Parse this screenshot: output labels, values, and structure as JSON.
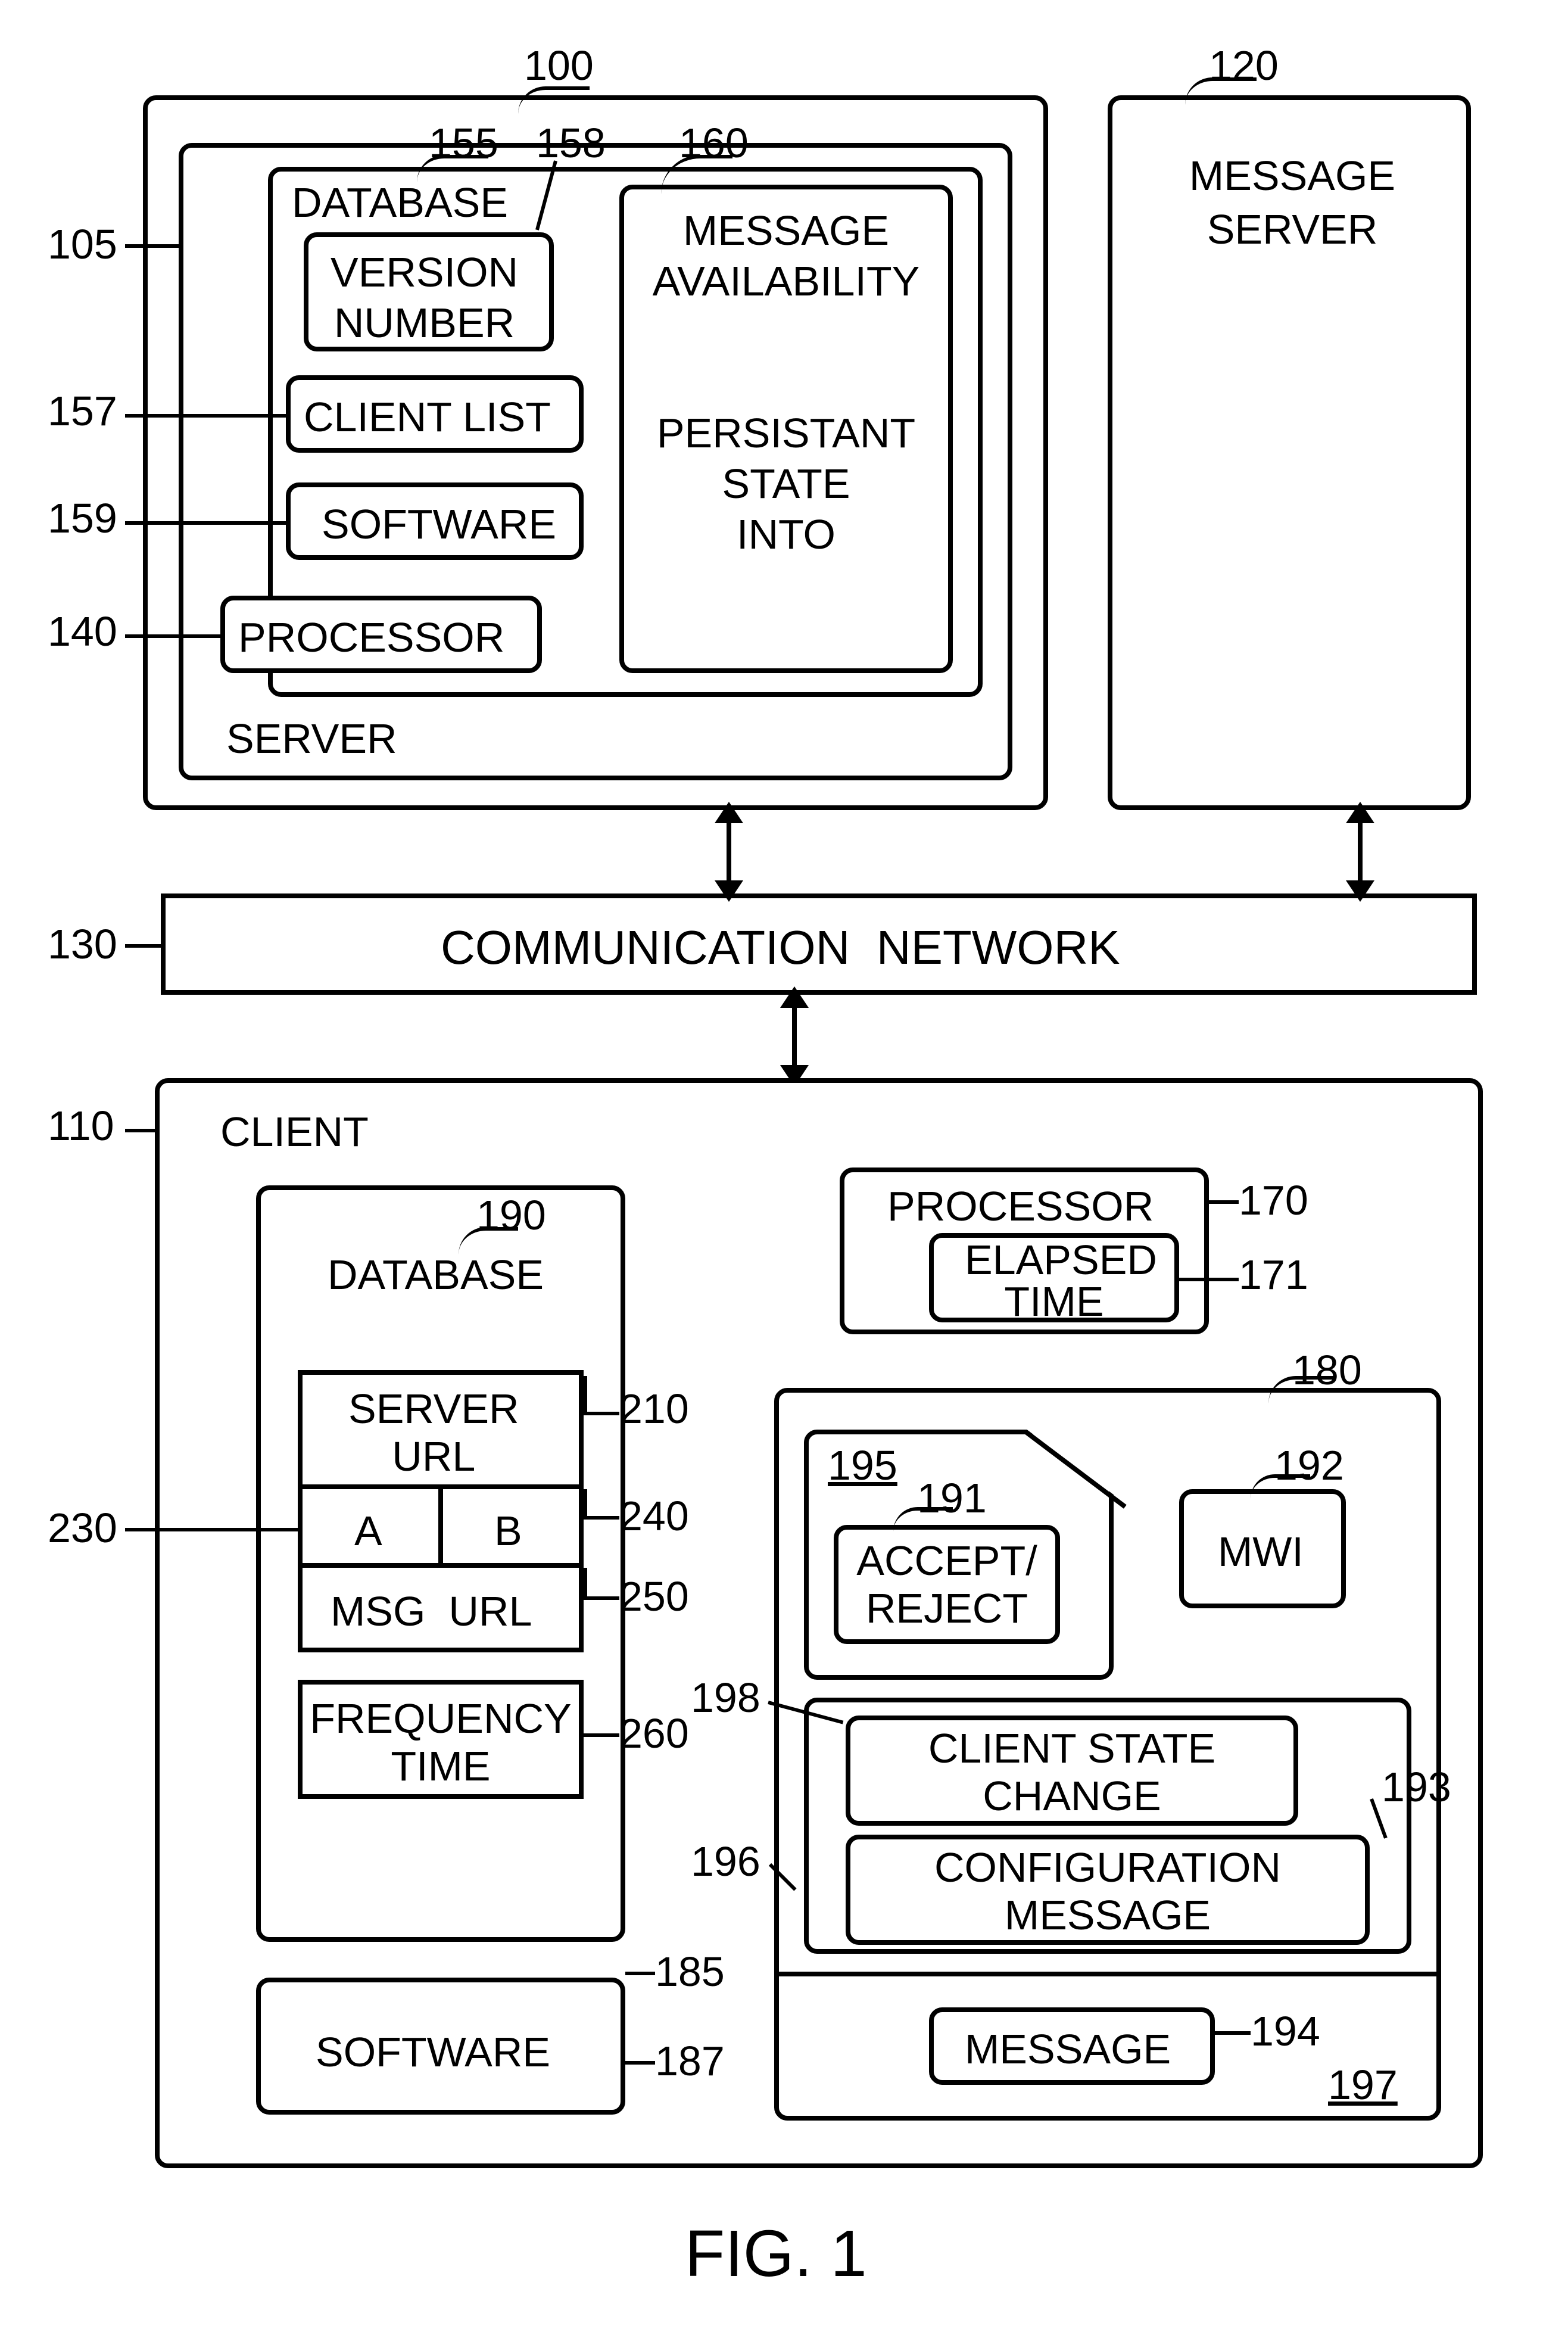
{
  "figure_caption": "FIG. 1",
  "refs": {
    "r100": "100",
    "r105": "105",
    "r110": "110",
    "r120": "120",
    "r130": "130",
    "r140": "140",
    "r155": "155",
    "r157": "157",
    "r158": "158",
    "r159": "159",
    "r160": "160",
    "r170": "170",
    "r171": "171",
    "r180": "180",
    "r185": "185",
    "r187": "187",
    "r190": "190",
    "r191": "191",
    "r192": "192",
    "r193": "193",
    "r194": "194",
    "r195": "195",
    "r196": "196",
    "r197": "197",
    "r198": "198",
    "r210": "210",
    "r230": "230",
    "r240": "240",
    "r250": "250",
    "r260": "260"
  },
  "blocks": {
    "server_outer": "SERVER",
    "database_s": "DATABASE",
    "version_number": "VERSION\nNUMBER",
    "client_list": "CLIENT LIST",
    "software_s": "SOFTWARE",
    "processor_s": "PROCESSOR",
    "msg_avail": "MESSAGE\nAVAILABILITY\n\n\nPERSISTANT\nSTATE\nINTO",
    "message_server": "MESSAGE\nSERVER",
    "comm_network": "COMMUNICATION  NETWORK",
    "client": "CLIENT",
    "database_c": "DATABASE",
    "server_url": "SERVER\nURL",
    "col_a": "A",
    "col_b": "B",
    "msg_url": "MSG  URL",
    "freq_time": "FREQUENCY\nTIME",
    "software_c": "SOFTWARE",
    "processor_c": "PROCESSOR",
    "elapsed_time": "ELAPSED\nTIME",
    "mwi": "MWI",
    "accept_reject": "ACCEPT/\nREJECT",
    "client_state_change": "CLIENT STATE\nCHANGE",
    "config_message": "CONFIGURATION\nMESSAGE",
    "message": "MESSAGE"
  }
}
